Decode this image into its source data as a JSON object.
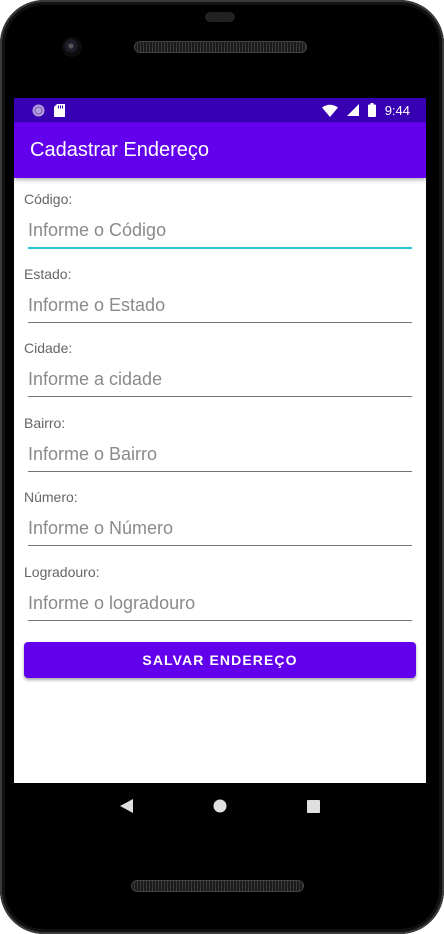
{
  "status_bar": {
    "time": "9:44",
    "left_icons": [
      "radio-icon",
      "sd-card-icon"
    ],
    "right_icons": [
      "wifi-icon",
      "signal-icon",
      "battery-icon"
    ]
  },
  "app_bar": {
    "title": "Cadastrar Endereço"
  },
  "form": {
    "fields": [
      {
        "label": "Código:",
        "placeholder": "Informe o Código",
        "value": "",
        "focused": true
      },
      {
        "label": "Estado:",
        "placeholder": "Informe o Estado",
        "value": "",
        "focused": false
      },
      {
        "label": "Cidade:",
        "placeholder": "Informe a cidade",
        "value": "",
        "focused": false
      },
      {
        "label": "Bairro:",
        "placeholder": "Informe o Bairro",
        "value": "",
        "focused": false
      },
      {
        "label": "Número:",
        "placeholder": "Informe o Número",
        "value": "",
        "focused": false
      },
      {
        "label": "Logradouro:",
        "placeholder": "Informe o logradouro",
        "value": "",
        "focused": false
      }
    ],
    "save_label": "SALVAR ENDEREÇO"
  },
  "nav_bar": {
    "buttons": [
      "back-icon",
      "home-icon",
      "recents-icon"
    ]
  },
  "colors": {
    "primary": "#6200ee",
    "primary_dark": "#3700b3",
    "accent_focus": "#26c6da"
  }
}
